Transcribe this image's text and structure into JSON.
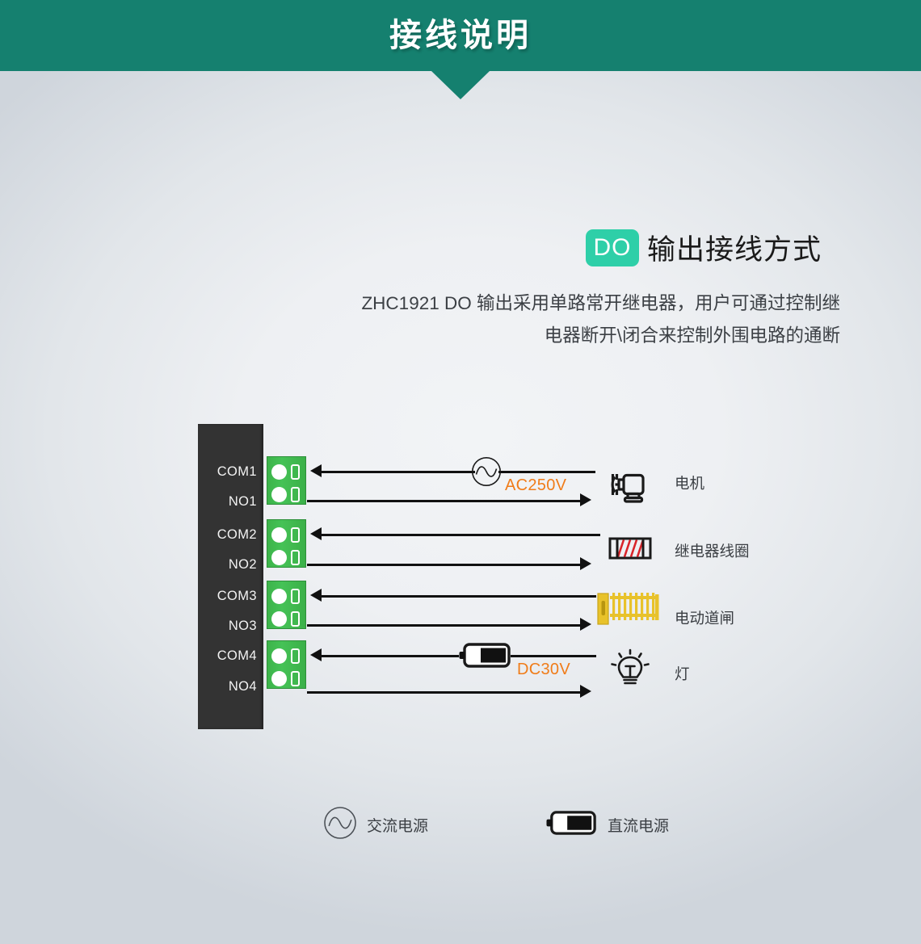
{
  "header": {
    "title": "接线说明",
    "bg_color": "#15806f",
    "text_color": "#ffffff"
  },
  "section": {
    "badge_label": "DO",
    "badge_color": "#2ecfa8",
    "title": "输出接线方式"
  },
  "description": {
    "line1": "ZHC1921 DO 输出采用单路常开继电器，用户可通过控制继",
    "line2": "电器断开\\闭合来控制外围电路的通断"
  },
  "terminal_block": {
    "body_color": "#333333",
    "connector_color": "#3cb44a",
    "pins": [
      {
        "label": "COM1"
      },
      {
        "label": "NO1"
      },
      {
        "label": "COM2"
      },
      {
        "label": "NO2"
      },
      {
        "label": "COM3"
      },
      {
        "label": "NO3"
      },
      {
        "label": "COM4"
      },
      {
        "label": "NO4"
      }
    ]
  },
  "circuits": [
    {
      "source_icon": "ac-source-icon",
      "voltage": "AC250V",
      "device_icon": "motor-icon",
      "device_label": "电机"
    },
    {
      "source_icon": "none",
      "voltage": "",
      "device_icon": "relay-coil-icon",
      "device_label": "继电器线圈"
    },
    {
      "source_icon": "none",
      "voltage": "",
      "device_icon": "barrier-gate-icon",
      "device_label": "电动道闸"
    },
    {
      "source_icon": "dc-source-icon",
      "voltage": "DC30V",
      "device_icon": "light-bulb-icon",
      "device_label": "灯"
    }
  ],
  "legend": [
    {
      "icon": "ac-source-icon",
      "label": "交流电源"
    },
    {
      "icon": "dc-source-icon",
      "label": "直流电源"
    }
  ],
  "colors": {
    "accent_orange": "#f07c19",
    "wire": "#111111",
    "barrier_yellow": "#e8c22a",
    "coil_red": "#d9242a",
    "text_dark": "#3a3e43"
  }
}
